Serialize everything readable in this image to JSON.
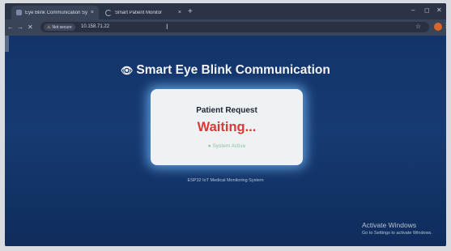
{
  "browser": {
    "tabs": [
      {
        "title": "Eye Blink Communication Syste",
        "close": "×"
      },
      {
        "title": "Smart Patient Monitor",
        "close": "×"
      }
    ],
    "new_tab": "+",
    "window_controls": {
      "minimize": "–",
      "maximize": "◻",
      "close": "✕"
    },
    "nav": {
      "back": "←",
      "forward": "→",
      "reload": "✕"
    },
    "security_label": "Not secure",
    "url": "10.158.71.22"
  },
  "page": {
    "title": "Smart Eye Blink Communication",
    "card": {
      "heading": "Patient Request",
      "status": "Waiting...",
      "system": "● System Active"
    },
    "footer": "ESP32 IoT Medical Monitoring System"
  },
  "os_watermark": {
    "line1": "Activate Windows",
    "line2": "Go to Settings to activate Windows."
  },
  "colors": {
    "page_background": "#163a72",
    "status_text": "#d93a35",
    "card_glow": "#78beff"
  },
  "icons": {
    "title_icon": "eye-icon",
    "security": "warning-icon"
  }
}
